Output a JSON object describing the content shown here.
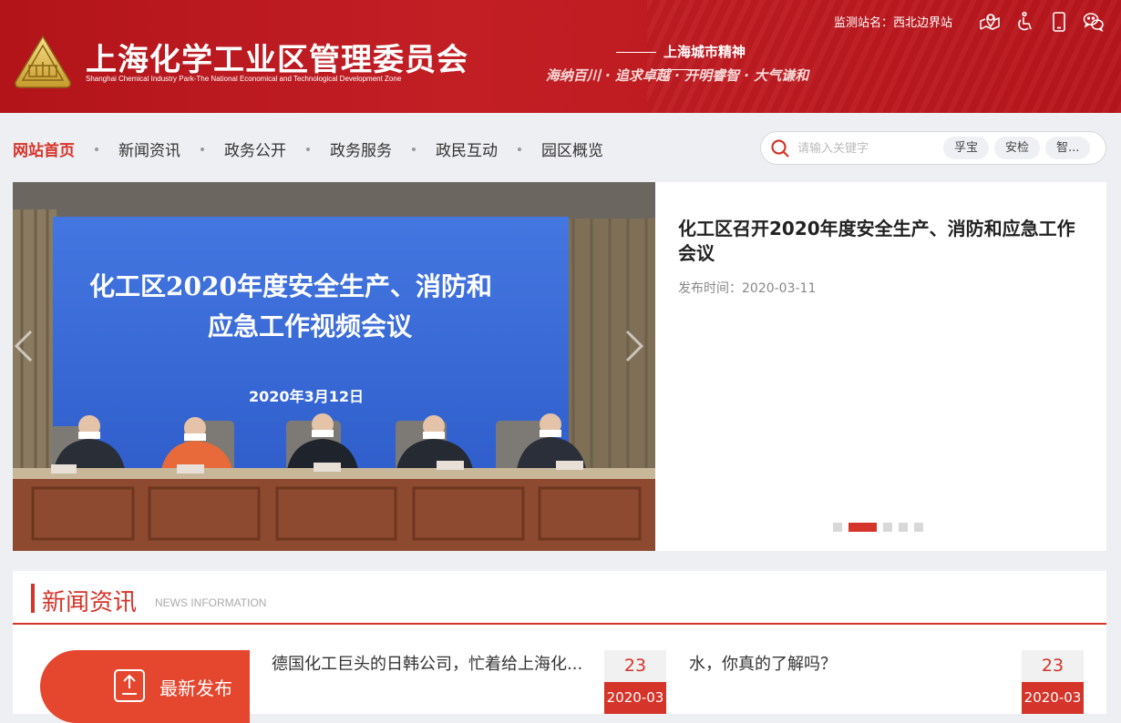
{
  "header": {
    "title": "上海化学工业区管理委员会",
    "subtitle": "Shanghai Chemical Industry Park-The National Economical and Technological Development Zone",
    "spirit_title": "上海城市精神",
    "spirit_motto": "海纳百川 · 追求卓越 · 开明睿智 · 大气谦和",
    "monitor_label": "监测站名：西北边界站",
    "icons": [
      "map-pin-icon",
      "wheelchair-icon",
      "mobile-phone-icon",
      "wechat-icon"
    ]
  },
  "nav": {
    "items": [
      {
        "label": "网站首页",
        "active": true
      },
      {
        "label": "新闻资讯"
      },
      {
        "label": "政务公开"
      },
      {
        "label": "政务服务"
      },
      {
        "label": "政民互动"
      },
      {
        "label": "园区概览"
      }
    ]
  },
  "search": {
    "placeholder": "请输入关键字",
    "chips": [
      "孚宝",
      "安检",
      "智..."
    ]
  },
  "slider": {
    "headline": "化工区召开2020年度安全生产、消防和应急工作会议",
    "pub_date": "发布时间：2020-03-11",
    "screen_line1": "化工区2020年度安全生产、消防和",
    "screen_line2": "应急工作视频会议",
    "screen_date": "2020年3月12日",
    "dots_count": 5,
    "active_dot": 1
  },
  "news": {
    "title": "新闻资讯",
    "title_en": "NEWS INFORMATION",
    "latest_label": "最新发布",
    "items": [
      {
        "text": "德国化工巨头的日韩公司，忙着给上海化...",
        "day": "23",
        "ym": "2020-03"
      },
      {
        "text": "水，你真的了解吗？",
        "day": "23",
        "ym": "2020-03"
      }
    ]
  },
  "colors": {
    "brand_red": "#c21f25",
    "accent": "#d5342a",
    "latest_orange": "#e5462e"
  }
}
